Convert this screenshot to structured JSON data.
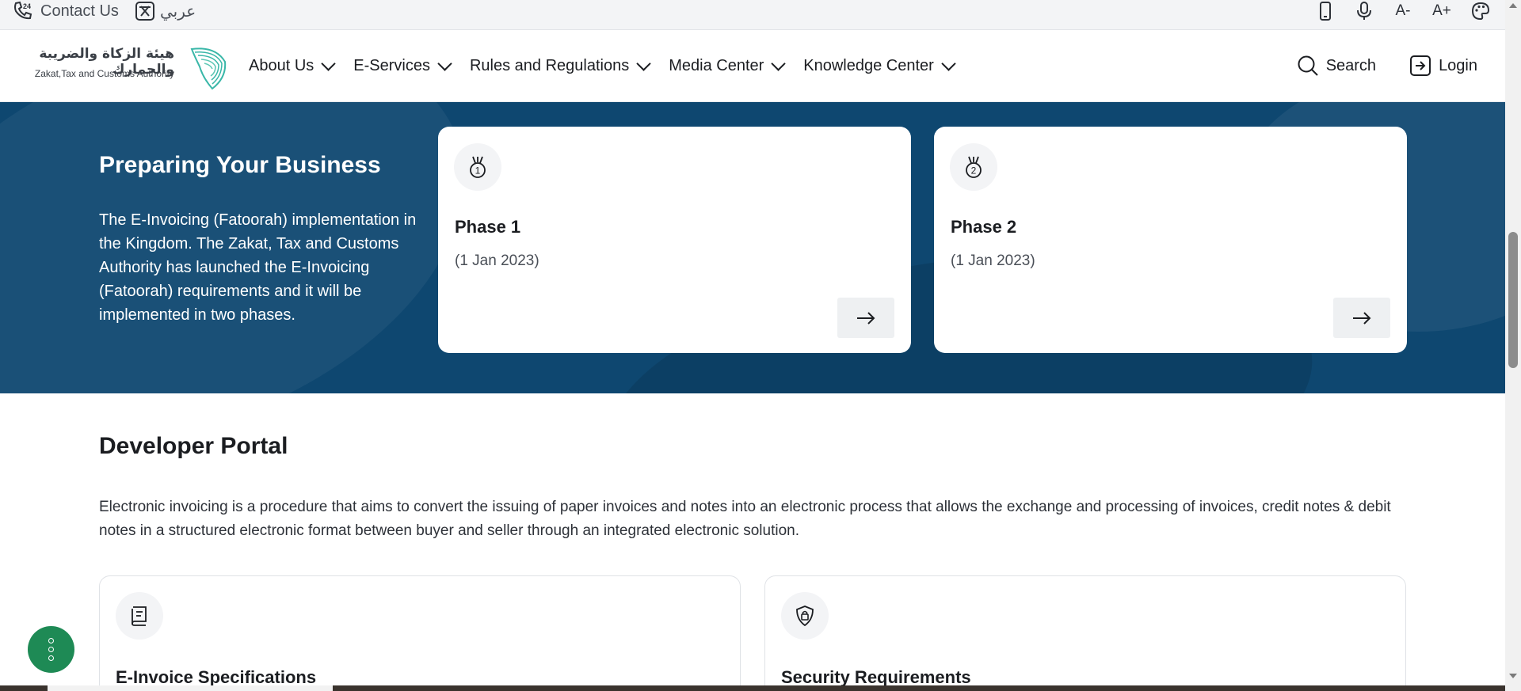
{
  "utility": {
    "contact_label": "Contact Us",
    "language_label": "عربي",
    "icons": [
      "mobile-icon",
      "microphone-icon",
      "decrease-font-icon",
      "increase-font-icon",
      "palette-icon"
    ],
    "decrease_font": "A-",
    "increase_font": "A+"
  },
  "header": {
    "logo_ar": "هيئة الزكاة والضريبة والجمارك",
    "logo_en": "Zakat,Tax and Customs Authority",
    "nav": [
      "About Us",
      "E-Services",
      "Rules and Regulations",
      "Media Center",
      "Knowledge Center"
    ],
    "search_label": "Search",
    "login_label": "Login"
  },
  "banner": {
    "title": "Preparing Your Business",
    "text": "The E-Invoicing (Fatoorah) implementation in the Kingdom. The Zakat, Tax and Customs Authority has launched the E-Invoicing (Fatoorah) requirements and it will be implemented in two phases.",
    "phases": [
      {
        "badge": "1",
        "title": "Phase 1",
        "date": "(1 Jan 2023)"
      },
      {
        "badge": "2",
        "title": "Phase 2",
        "date": "(1 Jan 2023)"
      }
    ]
  },
  "developer": {
    "title": "Developer Portal",
    "text": "Electronic invoicing is a procedure that aims to convert the issuing of paper invoices and notes into an electronic process that allows the exchange and processing of invoices, credit notes & debit notes in a structured electronic format between buyer and seller through an integrated electronic solution.",
    "cards": [
      {
        "title": "E-Invoice Specifications",
        "icon": "book-icon"
      },
      {
        "title": "Security Requirements",
        "icon": "shield-lock-icon"
      }
    ]
  },
  "colors": {
    "banner_bg": "#0e4770",
    "fab_bg": "#1e8a55",
    "logo_teal": "#39b7a8"
  }
}
